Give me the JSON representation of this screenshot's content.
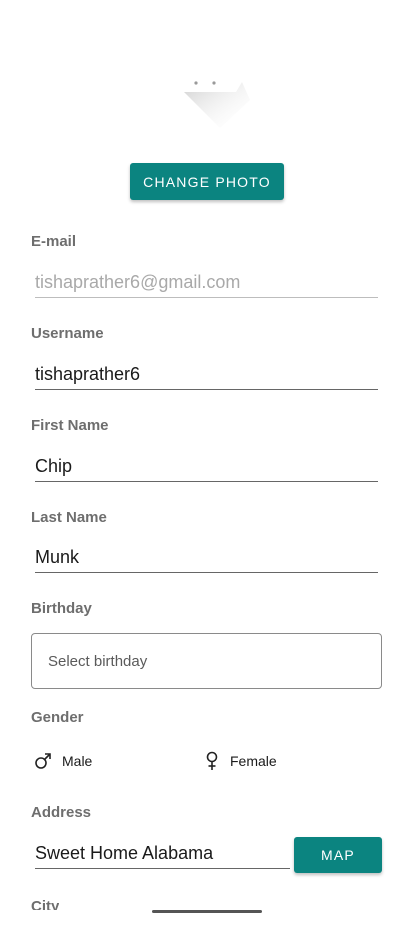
{
  "profile": {
    "change_photo_label": "CHANGE PHOTO"
  },
  "fields": {
    "email": {
      "label": "E-mail",
      "value": "tishaprather6@gmail.com"
    },
    "username": {
      "label": "Username",
      "value": "tishaprather6"
    },
    "first_name": {
      "label": "First Name",
      "value": "Chip"
    },
    "last_name": {
      "label": "Last Name",
      "value": "Munk"
    },
    "birthday": {
      "label": "Birthday",
      "placeholder": "Select birthday"
    },
    "gender": {
      "label": "Gender",
      "options": [
        "Male",
        "Female"
      ]
    },
    "address": {
      "label": "Address",
      "value": "Sweet Home Alabama",
      "map_label": "MAP"
    },
    "city": {
      "label": "City"
    }
  },
  "icons": {
    "photo": "image-placeholder-icon",
    "male": "male-icon",
    "female": "female-icon"
  },
  "colors": {
    "accent": "#0b8480"
  }
}
